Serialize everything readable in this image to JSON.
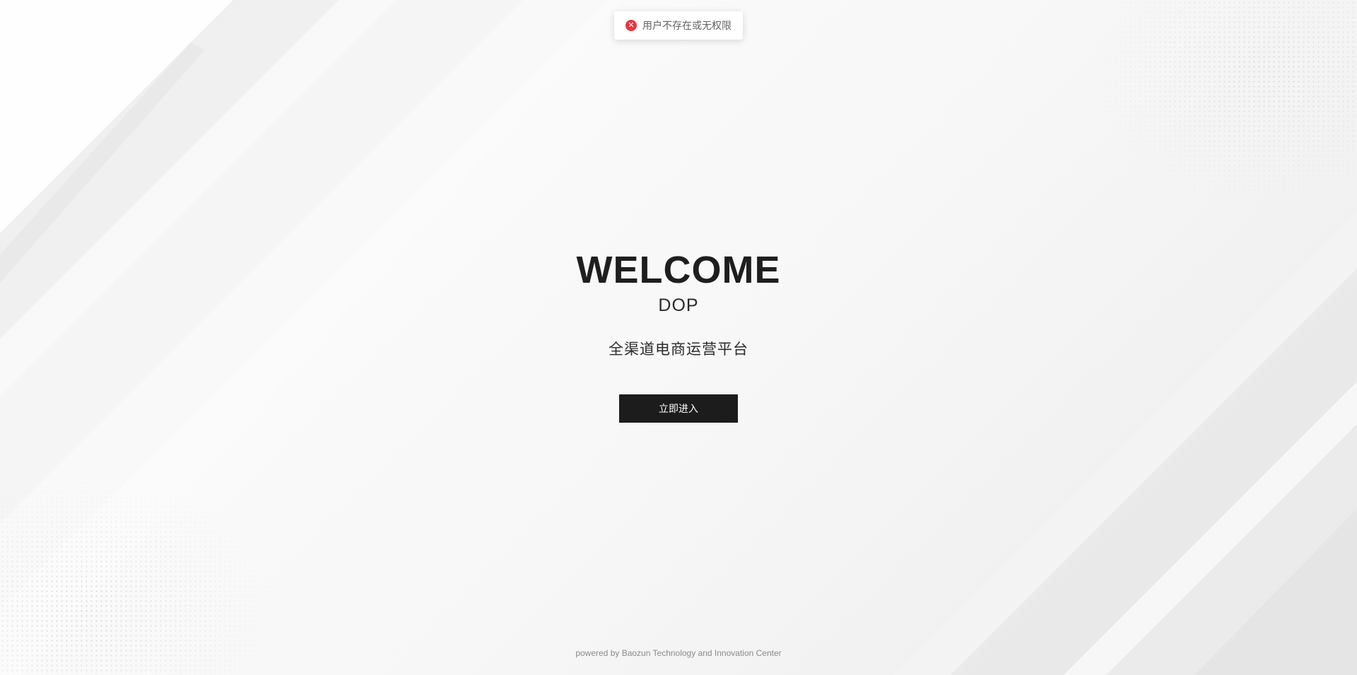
{
  "toast": {
    "icon": "error-circle-icon",
    "message": "用户不存在或无权限",
    "color": "#e8353e"
  },
  "hero": {
    "title": "WELCOME",
    "product": "DOP",
    "subtitle": "全渠道电商运营平台",
    "enter_label": "立即进入"
  },
  "footer": {
    "text": "powered by Baozun Technology and Innovation Center"
  },
  "colors": {
    "button_bg": "#1c1c1c",
    "title": "#1e1e1e"
  }
}
